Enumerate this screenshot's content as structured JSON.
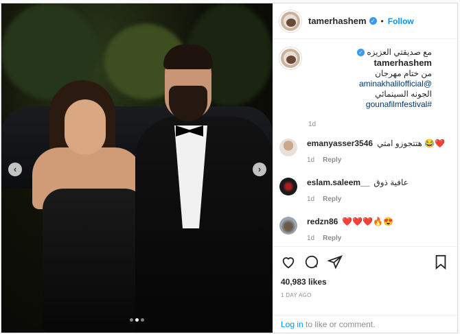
{
  "post": {
    "username": "tamerhashem",
    "follow_label": "Follow",
    "separator": "•",
    "caption_line1": "مع صديقتي العزيزه",
    "caption_mention": "@aminakhalilofficial",
    "caption_line2_rest": "من ختام مهرجان",
    "caption_hashtag": "#gounafilmfestival",
    "caption_line3": "الجونه السينمائي",
    "caption_time": "1d"
  },
  "comments": [
    {
      "username": "emanyasser3546",
      "text": "هتتجوزو امتي 😂❤️",
      "time": "1d",
      "reply": "Reply"
    },
    {
      "username": "eslam.saleem__",
      "text": "عافية ذوق",
      "time": "1d",
      "reply": "Reply"
    },
    {
      "username": "redzn86",
      "text": "❤️❤️❤️🔥😍",
      "time": "1d",
      "reply": "Reply"
    }
  ],
  "footer": {
    "likes": "40,983 likes",
    "posted_ago": "1 DAY AGO",
    "login_link": "Log in",
    "login_rest": " to like or comment."
  },
  "icons": [
    "verified-badge-icon",
    "heart-icon",
    "comment-icon",
    "share-icon",
    "bookmark-icon",
    "chevron-left-icon",
    "chevron-right-icon"
  ],
  "colors": {
    "accent": "#0095f6",
    "verified": "#3897f0",
    "muted": "#8e8e8e",
    "text": "#262626"
  }
}
